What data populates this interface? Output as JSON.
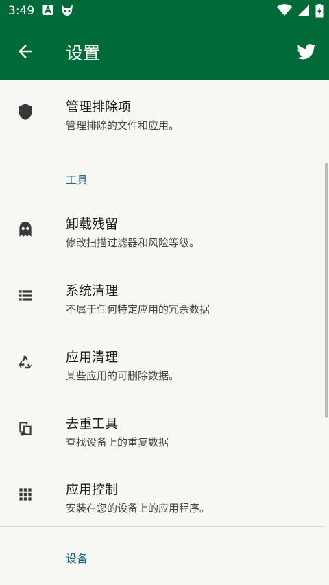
{
  "status_bar": {
    "time": "3:49"
  },
  "app_bar": {
    "title": "设置"
  },
  "sections": {
    "exclusions": {
      "title": "管理排除项",
      "summary": "管理排除的文件和应用。"
    },
    "tools_header": "工具",
    "corpse_finder": {
      "title": "卸载残留",
      "summary": "修改扫描过滤器和风险等级。"
    },
    "system_cleaner": {
      "title": "系统清理",
      "summary": "不属于任何特定应用的冗余数据"
    },
    "app_cleaner": {
      "title": "应用清理",
      "summary": "某些应用的可删除数据。"
    },
    "deduplicator": {
      "title": "去重工具",
      "summary": "查找设备上的重复数据"
    },
    "app_control": {
      "title": "应用控制",
      "summary": "安装在您的设备上的应用程序。"
    },
    "device_header": "设备"
  },
  "colors": {
    "primary": "#006b38",
    "section_header": "#1d6a86",
    "background": "#f7f8f4"
  }
}
